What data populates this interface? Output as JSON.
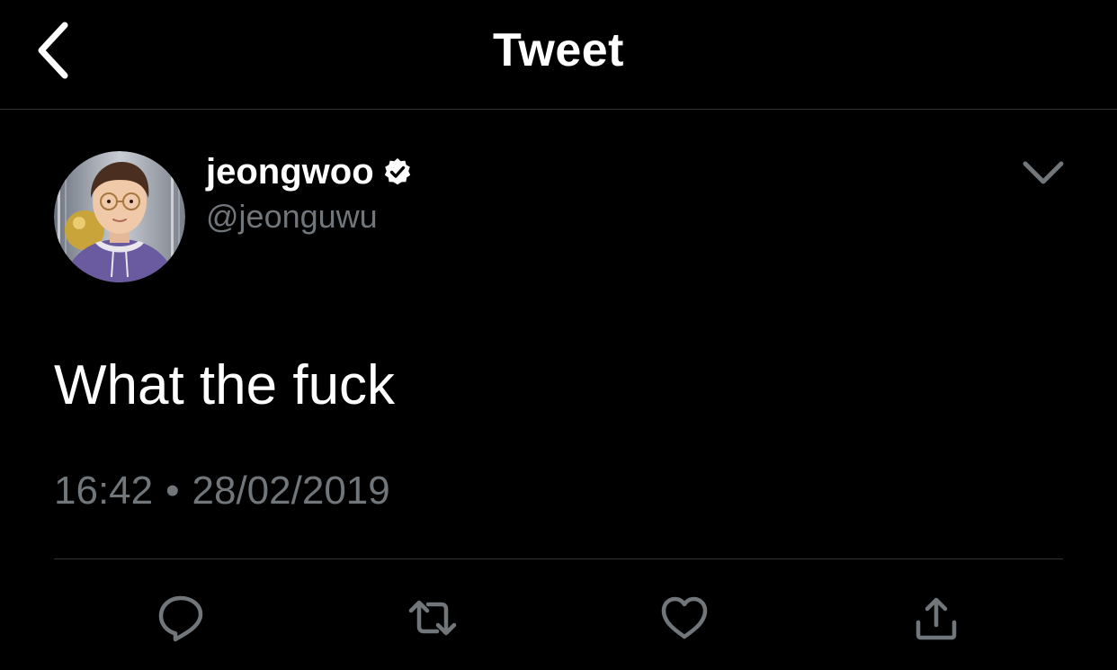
{
  "header": {
    "title": "Tweet",
    "back_icon": "chevron-left-icon"
  },
  "author": {
    "display_name": "jeongwoo",
    "handle": "@jeonguwu",
    "verified": true,
    "avatar_icon": "avatar-photo"
  },
  "tweet": {
    "text": "What the fuck",
    "time": "16:42",
    "separator": "•",
    "date": "28/02/2019"
  },
  "actions": [
    {
      "name": "reply",
      "icon": "reply-icon"
    },
    {
      "name": "retweet",
      "icon": "retweet-icon"
    },
    {
      "name": "like",
      "icon": "heart-icon"
    },
    {
      "name": "share",
      "icon": "share-icon"
    }
  ],
  "colors": {
    "background": "#000000",
    "text": "#ffffff",
    "secondary_text": "#71767b",
    "divider": "#2f3336",
    "icon": "#71767b"
  }
}
